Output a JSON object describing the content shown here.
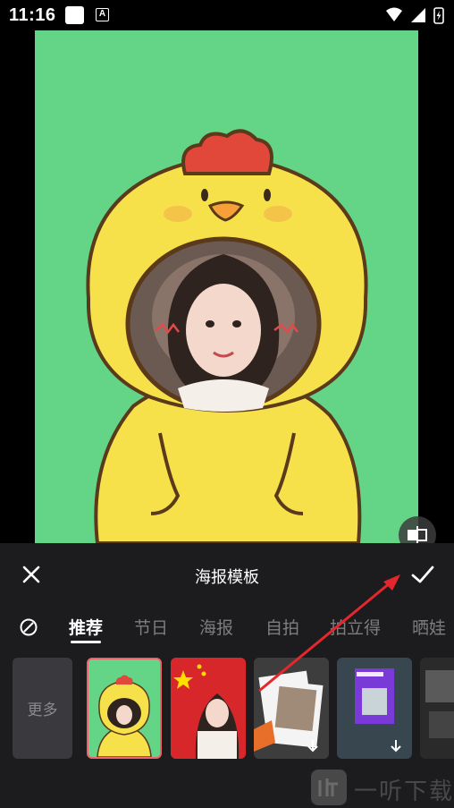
{
  "status_bar": {
    "time": "11:16",
    "notification_icon": "square-notification-icon",
    "a_icon_letter": "A"
  },
  "preview": {
    "poster_background": "#64d487",
    "compare_icon": "split-compare-icon"
  },
  "panel": {
    "title": "海报模板",
    "close_icon": "close-icon",
    "confirm_icon": "check-icon"
  },
  "tabs": {
    "none_icon": "no-filter-icon",
    "items": [
      {
        "label": "推荐",
        "active": true
      },
      {
        "label": "节日",
        "active": false
      },
      {
        "label": "海报",
        "active": false
      },
      {
        "label": "自拍",
        "active": false
      },
      {
        "label": "拍立得",
        "active": false
      },
      {
        "label": "晒娃",
        "active": false
      }
    ]
  },
  "templates": {
    "more_label": "更多",
    "items": [
      {
        "name": "chick-frame",
        "selected": true
      },
      {
        "name": "flag-portrait",
        "selected": false
      },
      {
        "name": "polaroid",
        "selected": false,
        "download": true
      },
      {
        "name": "next-poster",
        "selected": false,
        "download": true
      },
      {
        "name": "dark-poster",
        "selected": false
      }
    ]
  },
  "watermark": {
    "text": "一听下载"
  },
  "colors": {
    "accent_red": "#f0616b",
    "panel_bg": "#1c1c1e",
    "tab_inactive": "#7d7d80"
  }
}
